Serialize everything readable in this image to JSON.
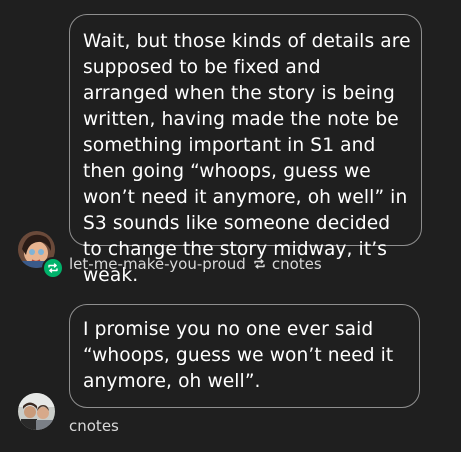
{
  "messages": [
    {
      "text": "Wait, but those kinds of details are supposed to be fixed and arranged when the story is being written, having made the note be something important in S1 and then going “whoops, guess we won’t need it anymore, oh well” in S3 sounds like someone decided to change the story midway, it’s weak.",
      "author": "let-me-make-you-proud",
      "reblogged_from": "cnotes",
      "avatar_icon": "user-avatar-icon",
      "badge_icon": "reblog-icon",
      "badge_color": "#00b36b"
    },
    {
      "text": "I promise you no one ever said “whoops, guess we won’t need it anymore, oh well”.",
      "author": "cnotes",
      "avatar_icon": "user-avatar-icon"
    }
  ],
  "colors": {
    "background": "#1f1f1f",
    "bubble_border": "#8f8f8f",
    "text": "#ffffff",
    "attribution_text": "#d9d9d9"
  }
}
